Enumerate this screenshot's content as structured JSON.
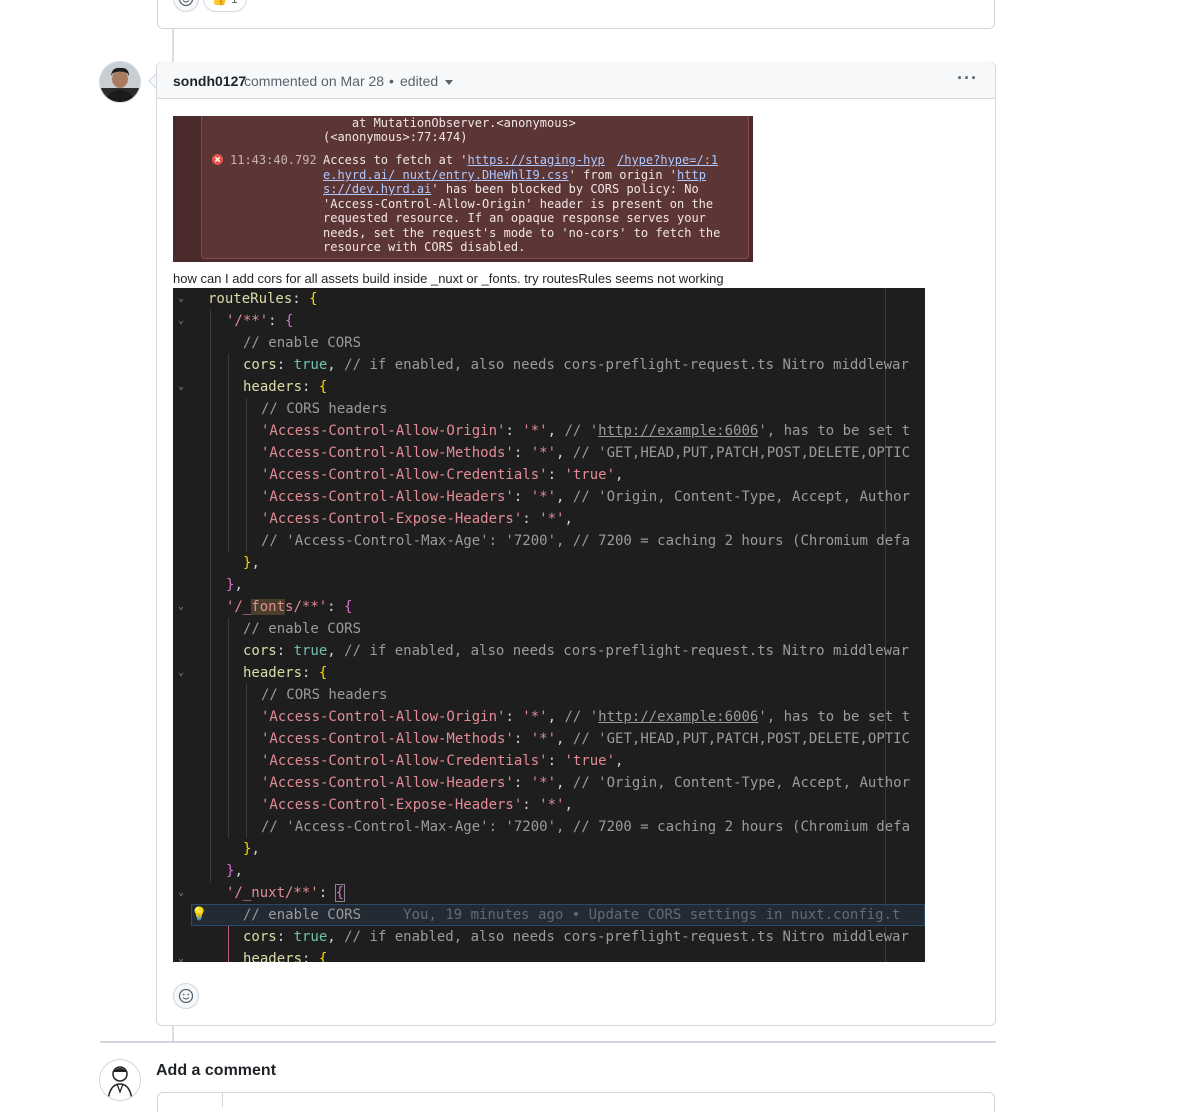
{
  "previous_comment": {
    "reaction_count": "1",
    "reaction_emoji": "👍"
  },
  "comment": {
    "author": "sondh0127",
    "meta_text": "commented on Mar 28",
    "separator": "•",
    "edited_label": "edited",
    "more_label": "···",
    "body_text": "how can I add cors for all assets build inside _nuxt or _fonts. try routesRules seems not working",
    "console_lines": {
      "line1": "    at MutationObserver.<anonymous>",
      "line2": "(<anonymous>:77:474)",
      "timestamp": "11:43:40.792",
      "msg_prefix": "Access to fetch at '",
      "link1": "https://staging-hyp",
      "link1b": "/hype?hype=/:1",
      "link2": "e.hyrd.ai/ nuxt/entry.DHeWhlI9.css",
      "msg_mid": "' from origin '",
      "link3": "http",
      "link4": "s://dev.hyrd.ai",
      "msg_line3_rest": "' has been blocked by CORS policy: No",
      "msg_line4": "'Access-Control-Allow-Origin' header is present on the",
      "msg_line5": "requested resource. If an opaque response serves your",
      "msg_line6": "needs, set the request's mode to 'no-cors' to fetch the",
      "msg_line7": "resource with CORS disabled."
    },
    "code": {
      "routeRules": "routeRules",
      "path_all": "'/**'",
      "path_fonts_a": "'/_",
      "path_fonts_b": "font",
      "path_fonts_c": "s/**'",
      "path_nuxt": "'/_nuxt/**'",
      "comment_enable": "// enable CORS",
      "cors_key": "cors",
      "true_val": "true",
      "cors_comment": "// if enabled, also needs cors-preflight-request.ts Nitro middlewar",
      "headers_key": "headers",
      "comment_headers": "// CORS headers",
      "h_origin": "'Access-Control-Allow-Origin'",
      "star": "'*'",
      "origin_comment_a": "// '",
      "origin_comment_link": "http://example:6006",
      "origin_comment_b": "', has to be set t",
      "h_methods": "'Access-Control-Allow-Methods'",
      "methods_comment": "// 'GET,HEAD,PUT,PATCH,POST,DELETE,OPTIC",
      "h_credentials": "'Access-Control-Allow-Credentials'",
      "true_str": "'true'",
      "h_headers": "'Access-Control-Allow-Headers'",
      "headers_comment": "// 'Origin, Content-Type, Accept, Author",
      "h_expose": "'Access-Control-Expose-Headers'",
      "max_age_comment": "// 'Access-Control-Max-Age': '7200', // 7200 = caching 2 hours (Chromium defa",
      "blame": "You, 19 minutes ago • Update CORS settings in nuxt.config.t"
    }
  },
  "add_comment": {
    "title": "Add a comment"
  },
  "colors": {
    "border": "#d0d7de",
    "header_bg": "#f6f8fa",
    "code_bg": "#1e1e1e",
    "console_bg": "#5c3535"
  }
}
